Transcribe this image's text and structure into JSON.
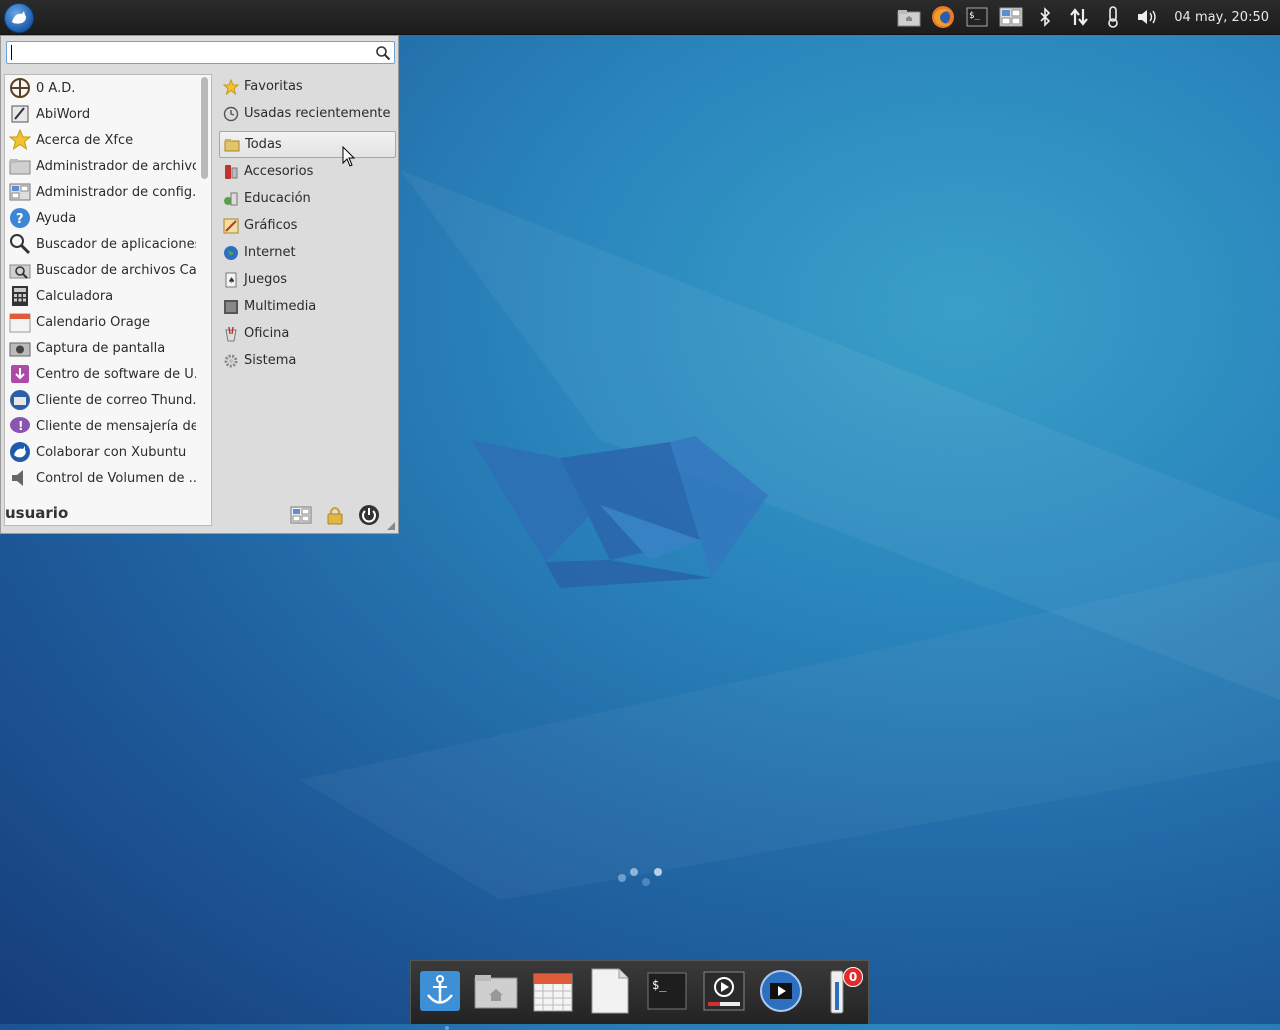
{
  "panel": {
    "clock": "04 may, 20:50",
    "tray_icons": [
      "folder-icon",
      "firefox-icon",
      "terminal-icon",
      "workspace-switcher-icon",
      "bluetooth-icon",
      "network-icon",
      "temperature-icon",
      "volume-icon"
    ]
  },
  "menu": {
    "search": {
      "value": "",
      "placeholder": ""
    },
    "apps": [
      {
        "label": "0 A.D.",
        "icon": "0ad-icon"
      },
      {
        "label": "AbiWord",
        "icon": "abiword-icon"
      },
      {
        "label": "Acerca de Xfce",
        "icon": "star-icon"
      },
      {
        "label": "Administrador de archivos",
        "icon": "file-manager-icon"
      },
      {
        "label": "Administrador de config...",
        "icon": "settings-manager-icon"
      },
      {
        "label": "Ayuda",
        "icon": "help-icon"
      },
      {
        "label": "Buscador de aplicaciones",
        "icon": "magnifier-icon"
      },
      {
        "label": "Buscador de archivos Ca...",
        "icon": "catfish-icon"
      },
      {
        "label": "Calculadora",
        "icon": "calculator-icon"
      },
      {
        "label": "Calendario Orage",
        "icon": "calendar-icon"
      },
      {
        "label": "Captura de pantalla",
        "icon": "camera-icon"
      },
      {
        "label": "Centro de software de U...",
        "icon": "software-center-icon"
      },
      {
        "label": "Cliente de correo Thund...",
        "icon": "thunderbird-icon"
      },
      {
        "label": "Cliente de mensajería de...",
        "icon": "pidgin-icon"
      },
      {
        "label": "Colaborar con Xubuntu",
        "icon": "xubuntu-icon"
      },
      {
        "label": "Control de Volumen de ...",
        "icon": "speaker-icon"
      }
    ],
    "categories": [
      {
        "label": "Favoritas",
        "icon": "star-icon"
      },
      {
        "label": "Usadas recientemente",
        "icon": "clock-icon"
      },
      {
        "label": "Todas",
        "icon": "folder-icon",
        "selected": true
      },
      {
        "label": "Accesorios",
        "icon": "accessories-icon"
      },
      {
        "label": "Educación",
        "icon": "education-icon"
      },
      {
        "label": "Gráficos",
        "icon": "graphics-icon"
      },
      {
        "label": "Internet",
        "icon": "globe-icon"
      },
      {
        "label": "Juegos",
        "icon": "games-icon"
      },
      {
        "label": "Multimedia",
        "icon": "multimedia-icon"
      },
      {
        "label": "Oficina",
        "icon": "office-icon"
      },
      {
        "label": "Sistema",
        "icon": "gear-icon"
      }
    ],
    "username": "usuario",
    "footer_actions": [
      "settings-icon",
      "lock-icon",
      "power-icon"
    ]
  },
  "dock": {
    "items": [
      "anchor-icon",
      "home-folder-icon",
      "calendar-icon",
      "document-icon",
      "terminal-icon",
      "media-player-icon",
      "video-editor-icon",
      "thermometer-icon"
    ],
    "badge": "0"
  },
  "colors": {
    "accent": "#2a86bd",
    "selection_border": "#6da4d6",
    "badge": "#e12b2b"
  }
}
